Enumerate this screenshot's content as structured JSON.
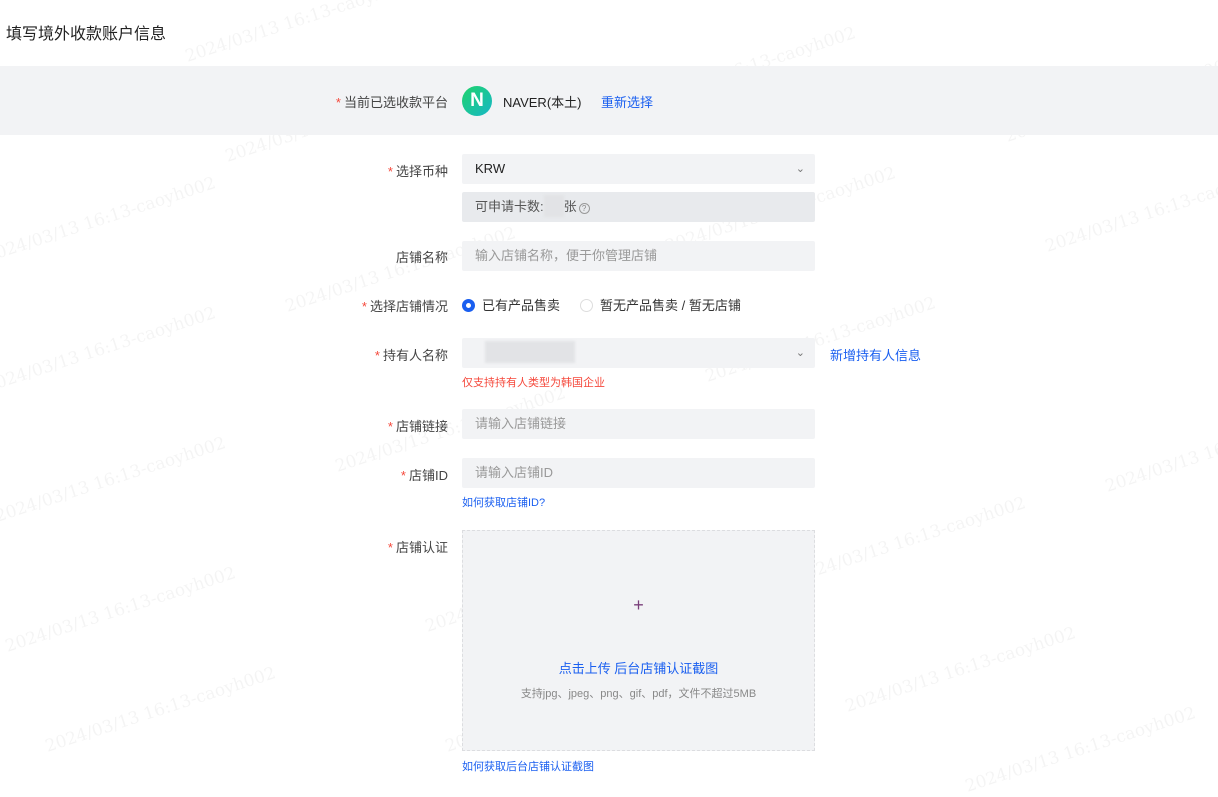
{
  "page_title": "填写境外收款账户信息",
  "watermark": "2024/03/13 16:13-caoyh002",
  "platform": {
    "label": "当前已选收款平台",
    "logo_letter": "N",
    "name": "NAVER(本土)",
    "reselect": "重新选择"
  },
  "currency": {
    "label": "选择币种",
    "value": "KRW",
    "card_count_prefix": "可申请卡数:",
    "card_count_suffix": "张",
    "help": "?"
  },
  "shop_name": {
    "label": "店铺名称",
    "placeholder": "输入店铺名称，便于你管理店铺"
  },
  "shop_status": {
    "label": "选择店铺情况",
    "options": [
      "已有产品售卖",
      "暂无产品售卖 / 暂无店铺"
    ],
    "selected": 0
  },
  "holder": {
    "label": "持有人名称",
    "add": "新增持有人信息",
    "warning": "仅支持持有人类型为韩国企业"
  },
  "shop_link": {
    "label": "店铺链接",
    "placeholder": "请输入店铺链接"
  },
  "shop_id": {
    "label": "店铺ID",
    "placeholder": "请输入店铺ID",
    "help_link": "如何获取店铺ID?"
  },
  "shop_cert": {
    "label": "店铺认证",
    "plus": "+",
    "upload_text": "点击上传 后台店铺认证截图",
    "hint": "支持jpg、jpeg、png、gif、pdf，文件不超过5MB",
    "help_link": "如何获取后台店铺认证截图"
  },
  "required_mark": "*"
}
